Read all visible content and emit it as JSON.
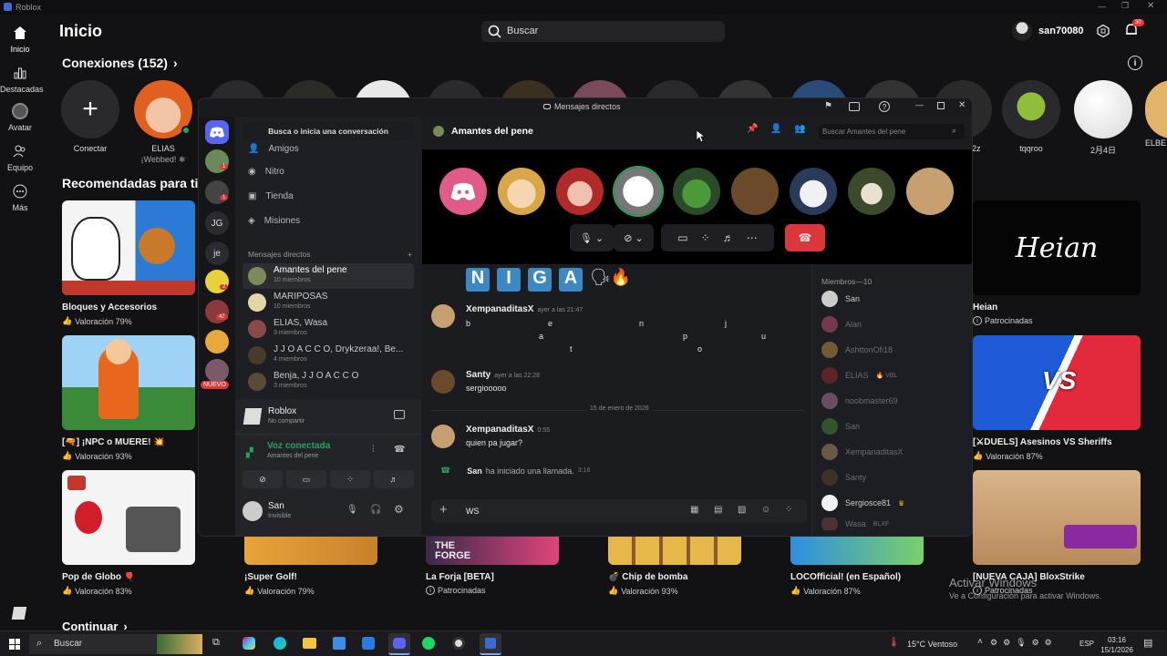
{
  "window": {
    "title": "Roblox"
  },
  "nav": {
    "items": [
      {
        "label": "Inicio"
      },
      {
        "label": "Destacadas"
      },
      {
        "label": "Avatar"
      },
      {
        "label": "Equipo"
      },
      {
        "label": "Más"
      }
    ]
  },
  "header": {
    "page_title": "Inicio",
    "search_placeholder": "Buscar",
    "username": "san70080",
    "notification_count": "30"
  },
  "connections": {
    "title": "Conexiones (152)",
    "items": [
      {
        "name": "Conectar",
        "status": ""
      },
      {
        "name": "ELIAS",
        "status": "¡Webbed! ❄"
      },
      {
        "name": "tqqroo",
        "status": ""
      },
      {
        "name": "2月4日",
        "status": ""
      },
      {
        "name": "ELBE",
        "status": ""
      },
      {
        "name": "2z",
        "status": ""
      }
    ]
  },
  "sections": {
    "recommended": "Recomendadas para ti",
    "continue": "Continuar"
  },
  "games": [
    {
      "title": "Bloques y Accesorios",
      "sub": "Valoración 79%"
    },
    {
      "title": "Heian",
      "sub": "Patrocinadas"
    },
    {
      "title": "[🔫] ¡NPC o MUERE! 💥",
      "sub": "Valoración 93%"
    },
    {
      "title": "[⚔DUELS] Asesinos VS Sheriffs",
      "sub": "Valoración 87%"
    },
    {
      "title": "Pop de Globo 🎈",
      "sub": "Valoración 83%"
    },
    {
      "title": "¡Super Golf!",
      "sub": "Valoración 79%"
    },
    {
      "title": "La Forja [BETA]",
      "sub": "Patrocinadas"
    },
    {
      "title": "💣 Chip de bomba",
      "sub": "Valoración 93%"
    },
    {
      "title": "LOCOfficial! (en Español)",
      "sub": "Valoración 87%"
    },
    {
      "title": "[NUEVA CAJA] BloxStrike",
      "sub": "Patrocinadas"
    }
  ],
  "heian_logo": "Heian",
  "forge_logo": "THE FORGE",
  "vs_label": "VS",
  "discord": {
    "window_title": "Mensajes directos",
    "search_conv": "Busca o inicia una conversación",
    "menu": [
      {
        "label": "Amigos"
      },
      {
        "label": "Nitro"
      },
      {
        "label": "Tienda"
      },
      {
        "label": "Misiones"
      }
    ],
    "dm_header": "Mensajes directos",
    "dms": [
      {
        "name": "Amantes del pene",
        "sub": "10 miembros"
      },
      {
        "name": "MARIPOSAS",
        "sub": "10 miembros"
      },
      {
        "name": "ELIAS, Wasa",
        "sub": "3 miembros"
      },
      {
        "name": "J J O A C C O, Drykzeraa!, Be...",
        "sub": "4 miembros"
      },
      {
        "name": "Benja, J J O A C C O",
        "sub": "3 miembros"
      }
    ],
    "activity": {
      "name": "Roblox",
      "sub": "No compartir"
    },
    "voice": {
      "status": "Voz conectada",
      "channel": "Amantes del pene"
    },
    "user": {
      "name": "San",
      "status": "Invisible"
    },
    "guild_badges": [
      "1",
      "1",
      "2",
      "47"
    ],
    "guild_letters": [
      "JG",
      "je"
    ],
    "new_badge": "NUEVO",
    "channel_name": "Amantes del pene",
    "channel_search": "Buscar Amantes del pene",
    "banner_letters": [
      "N",
      "I",
      "G",
      "A"
    ],
    "messages": [
      {
        "user": "XempanaditasX",
        "time": "ayer a las 21:47"
      },
      {
        "user": "Santy",
        "time": "ayer a las 22:28",
        "text": "sergiooooo"
      },
      {
        "user": "XempanaditasX",
        "time": "0:55",
        "text": "quien pa jugar?"
      }
    ],
    "scatter_letters": [
      "b",
      "e",
      "n",
      "j",
      "a",
      "p",
      "u",
      "t",
      "o"
    ],
    "date_divider": "15 de enero de 2026",
    "system": {
      "user": "San",
      "text": "ha iniciado una llamada.",
      "time": "3:16"
    },
    "input_value": "WS",
    "members_header": "Miembros—10",
    "members": [
      "San",
      "Alan",
      "AshttonOfi18",
      "ELIAS",
      "noobmaster69",
      "San",
      "XempanaditasX",
      "Santy",
      "Sergiosce81",
      "Wasa"
    ],
    "member_tags": {
      "elias": "VBL",
      "wasa": "BLXF"
    }
  },
  "windows_notice": {
    "line1": "Activar Windows",
    "line2": "Ve a Configuración para activar Windows."
  },
  "taskbar": {
    "search": "Buscar",
    "weather": "15°C  Ventoso",
    "lang": "ESP",
    "time": "03:16",
    "date": "15/1/2026"
  },
  "colors": {
    "discord_blurple": "#5865f2",
    "voice_green": "#23a55a",
    "hangup_red": "#da373c",
    "online": "#23a55a"
  }
}
